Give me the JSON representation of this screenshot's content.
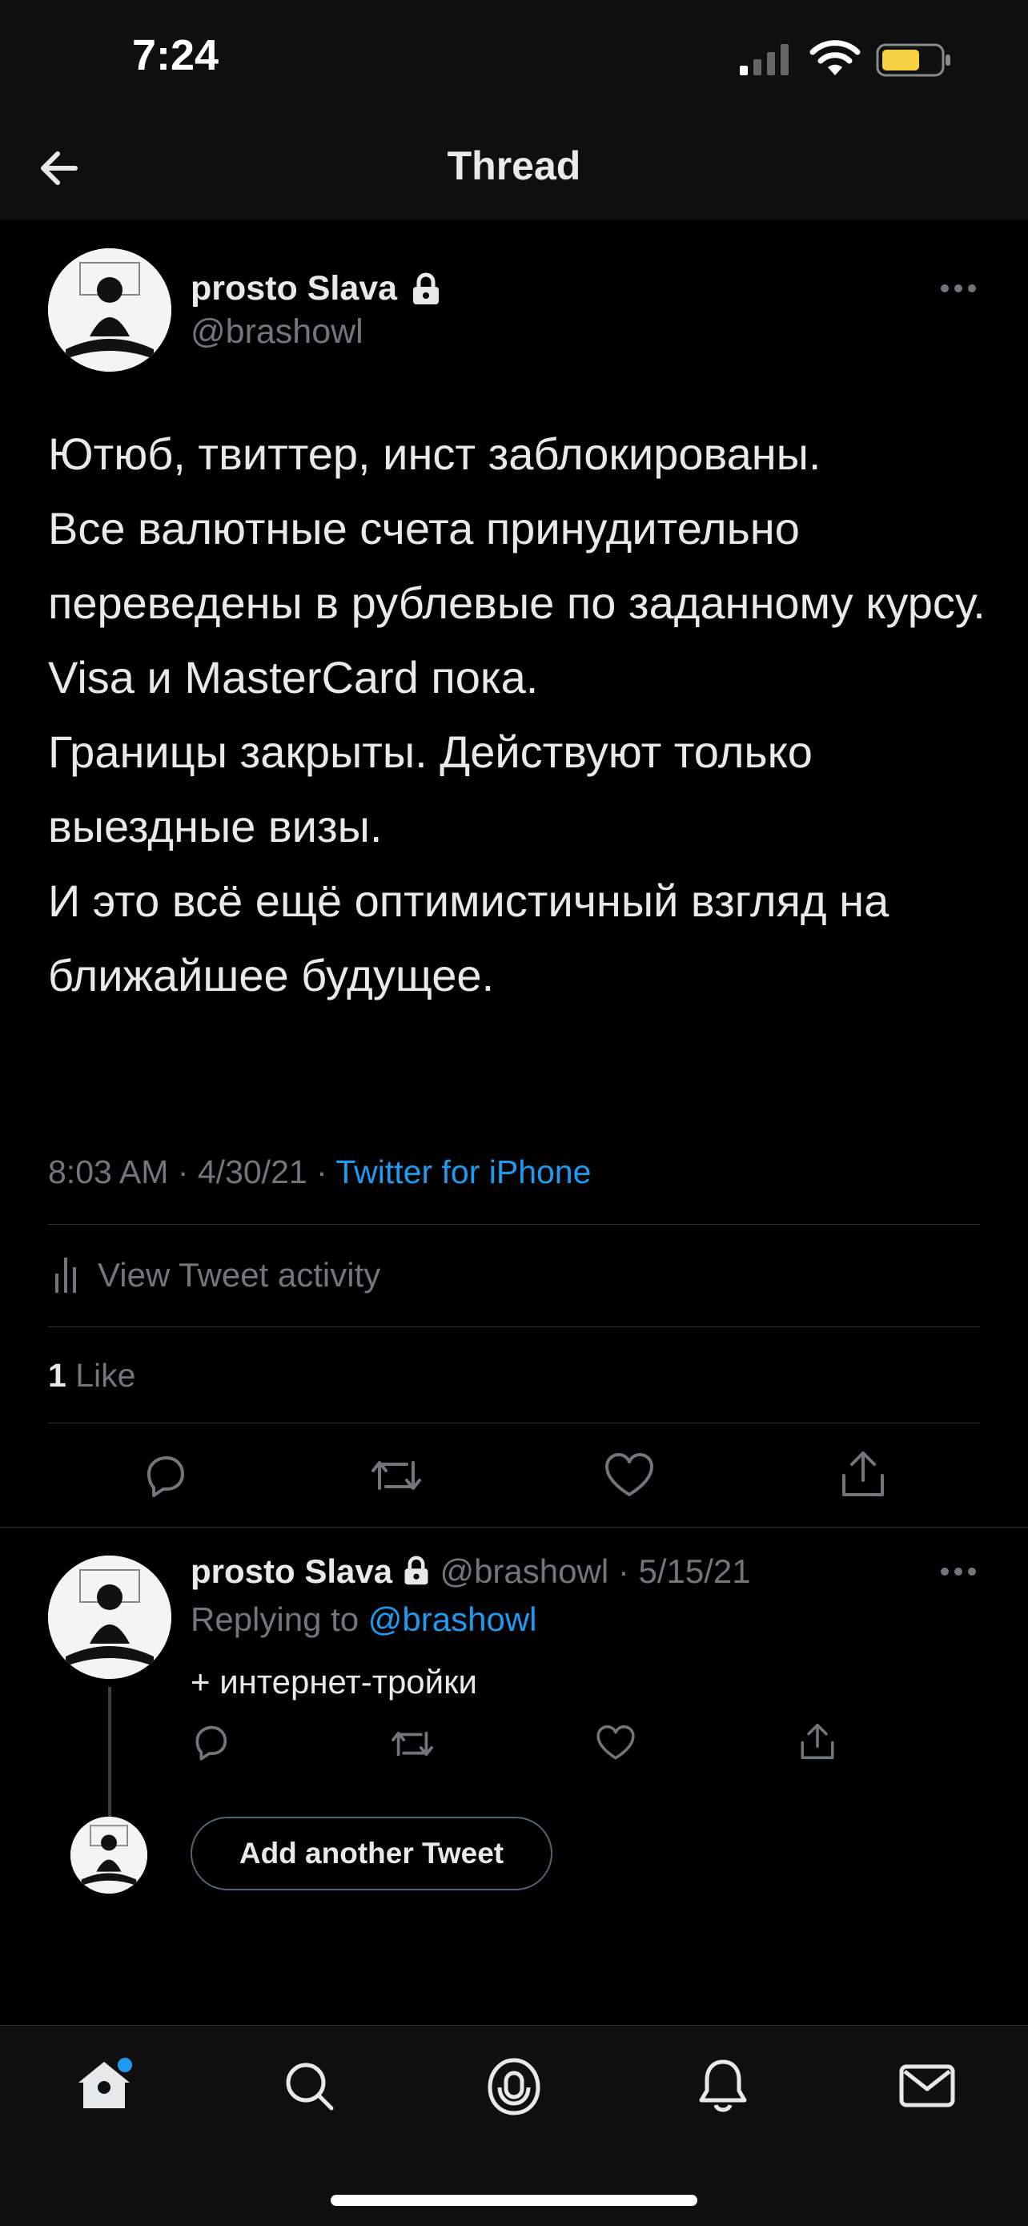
{
  "status_bar": {
    "time": "7:24",
    "battery_color": "#f5d142"
  },
  "nav": {
    "title": "Thread",
    "back_icon": "back-arrow-icon"
  },
  "tweet": {
    "author_name": "prosto Slava",
    "handle": "@brashowl",
    "text": "Ютюб, твиттер, инст заблокированы.\nВсе валютные счета принудительно переведены в рублевые по заданному курсу.\nVisa и MasterCard пока.\nГраницы закрыты. Действуют только выездные визы.\nИ это всё ещё оптимистичный взгляд на ближайшее будущее.",
    "time": "8:03 AM",
    "date": "4/30/21",
    "source": "Twitter for iPhone",
    "activity_label": "View Tweet activity",
    "likes_count": "1",
    "likes_label": "Like"
  },
  "reply": {
    "author_name": "prosto Slava",
    "handle": "@brashowl",
    "date": "5/15/21",
    "replying_to_label": "Replying to",
    "replying_to_handle": "@brashowl",
    "text": "+ интернет-тройки"
  },
  "compose": {
    "add_label": "Add another Tweet"
  },
  "tabbar": {
    "active": "home",
    "notification_dot_color": "#1d9bf0"
  },
  "colors": {
    "accent": "#1d9bf0",
    "background": "#000000",
    "muted": "#71767b"
  }
}
